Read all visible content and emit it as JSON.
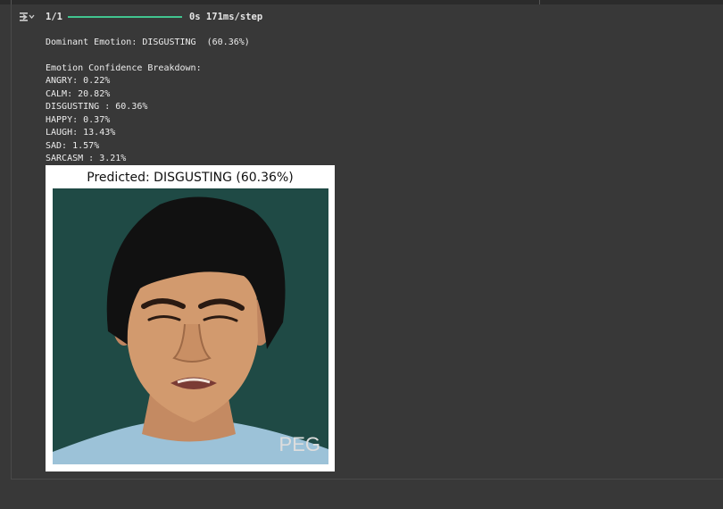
{
  "progress": {
    "step": "1/1",
    "fraction": 1.0,
    "timing": "0s 171ms/step"
  },
  "output": {
    "dominant": "Dominant Emotion: DISGUSTING  (60.36%)",
    "breakdown_header": "Emotion Confidence Breakdown:",
    "lines": [
      "ANGRY: 0.22%",
      "CALM: 20.82%",
      "DISGUSTING : 60.36%",
      "HAPPY: 0.37%",
      "LAUGH: 13.43%",
      "SAD: 1.57%",
      "SARCASM : 3.21%"
    ]
  },
  "figure": {
    "title": "Predicted: DISGUSTING  (60.36%)",
    "watermark": "PEG"
  },
  "colors": {
    "background": "#383838",
    "progress": "#41c48f",
    "photo_background": "#1f4a45"
  },
  "icons": {
    "output_toggle": "output-expand-icon"
  }
}
